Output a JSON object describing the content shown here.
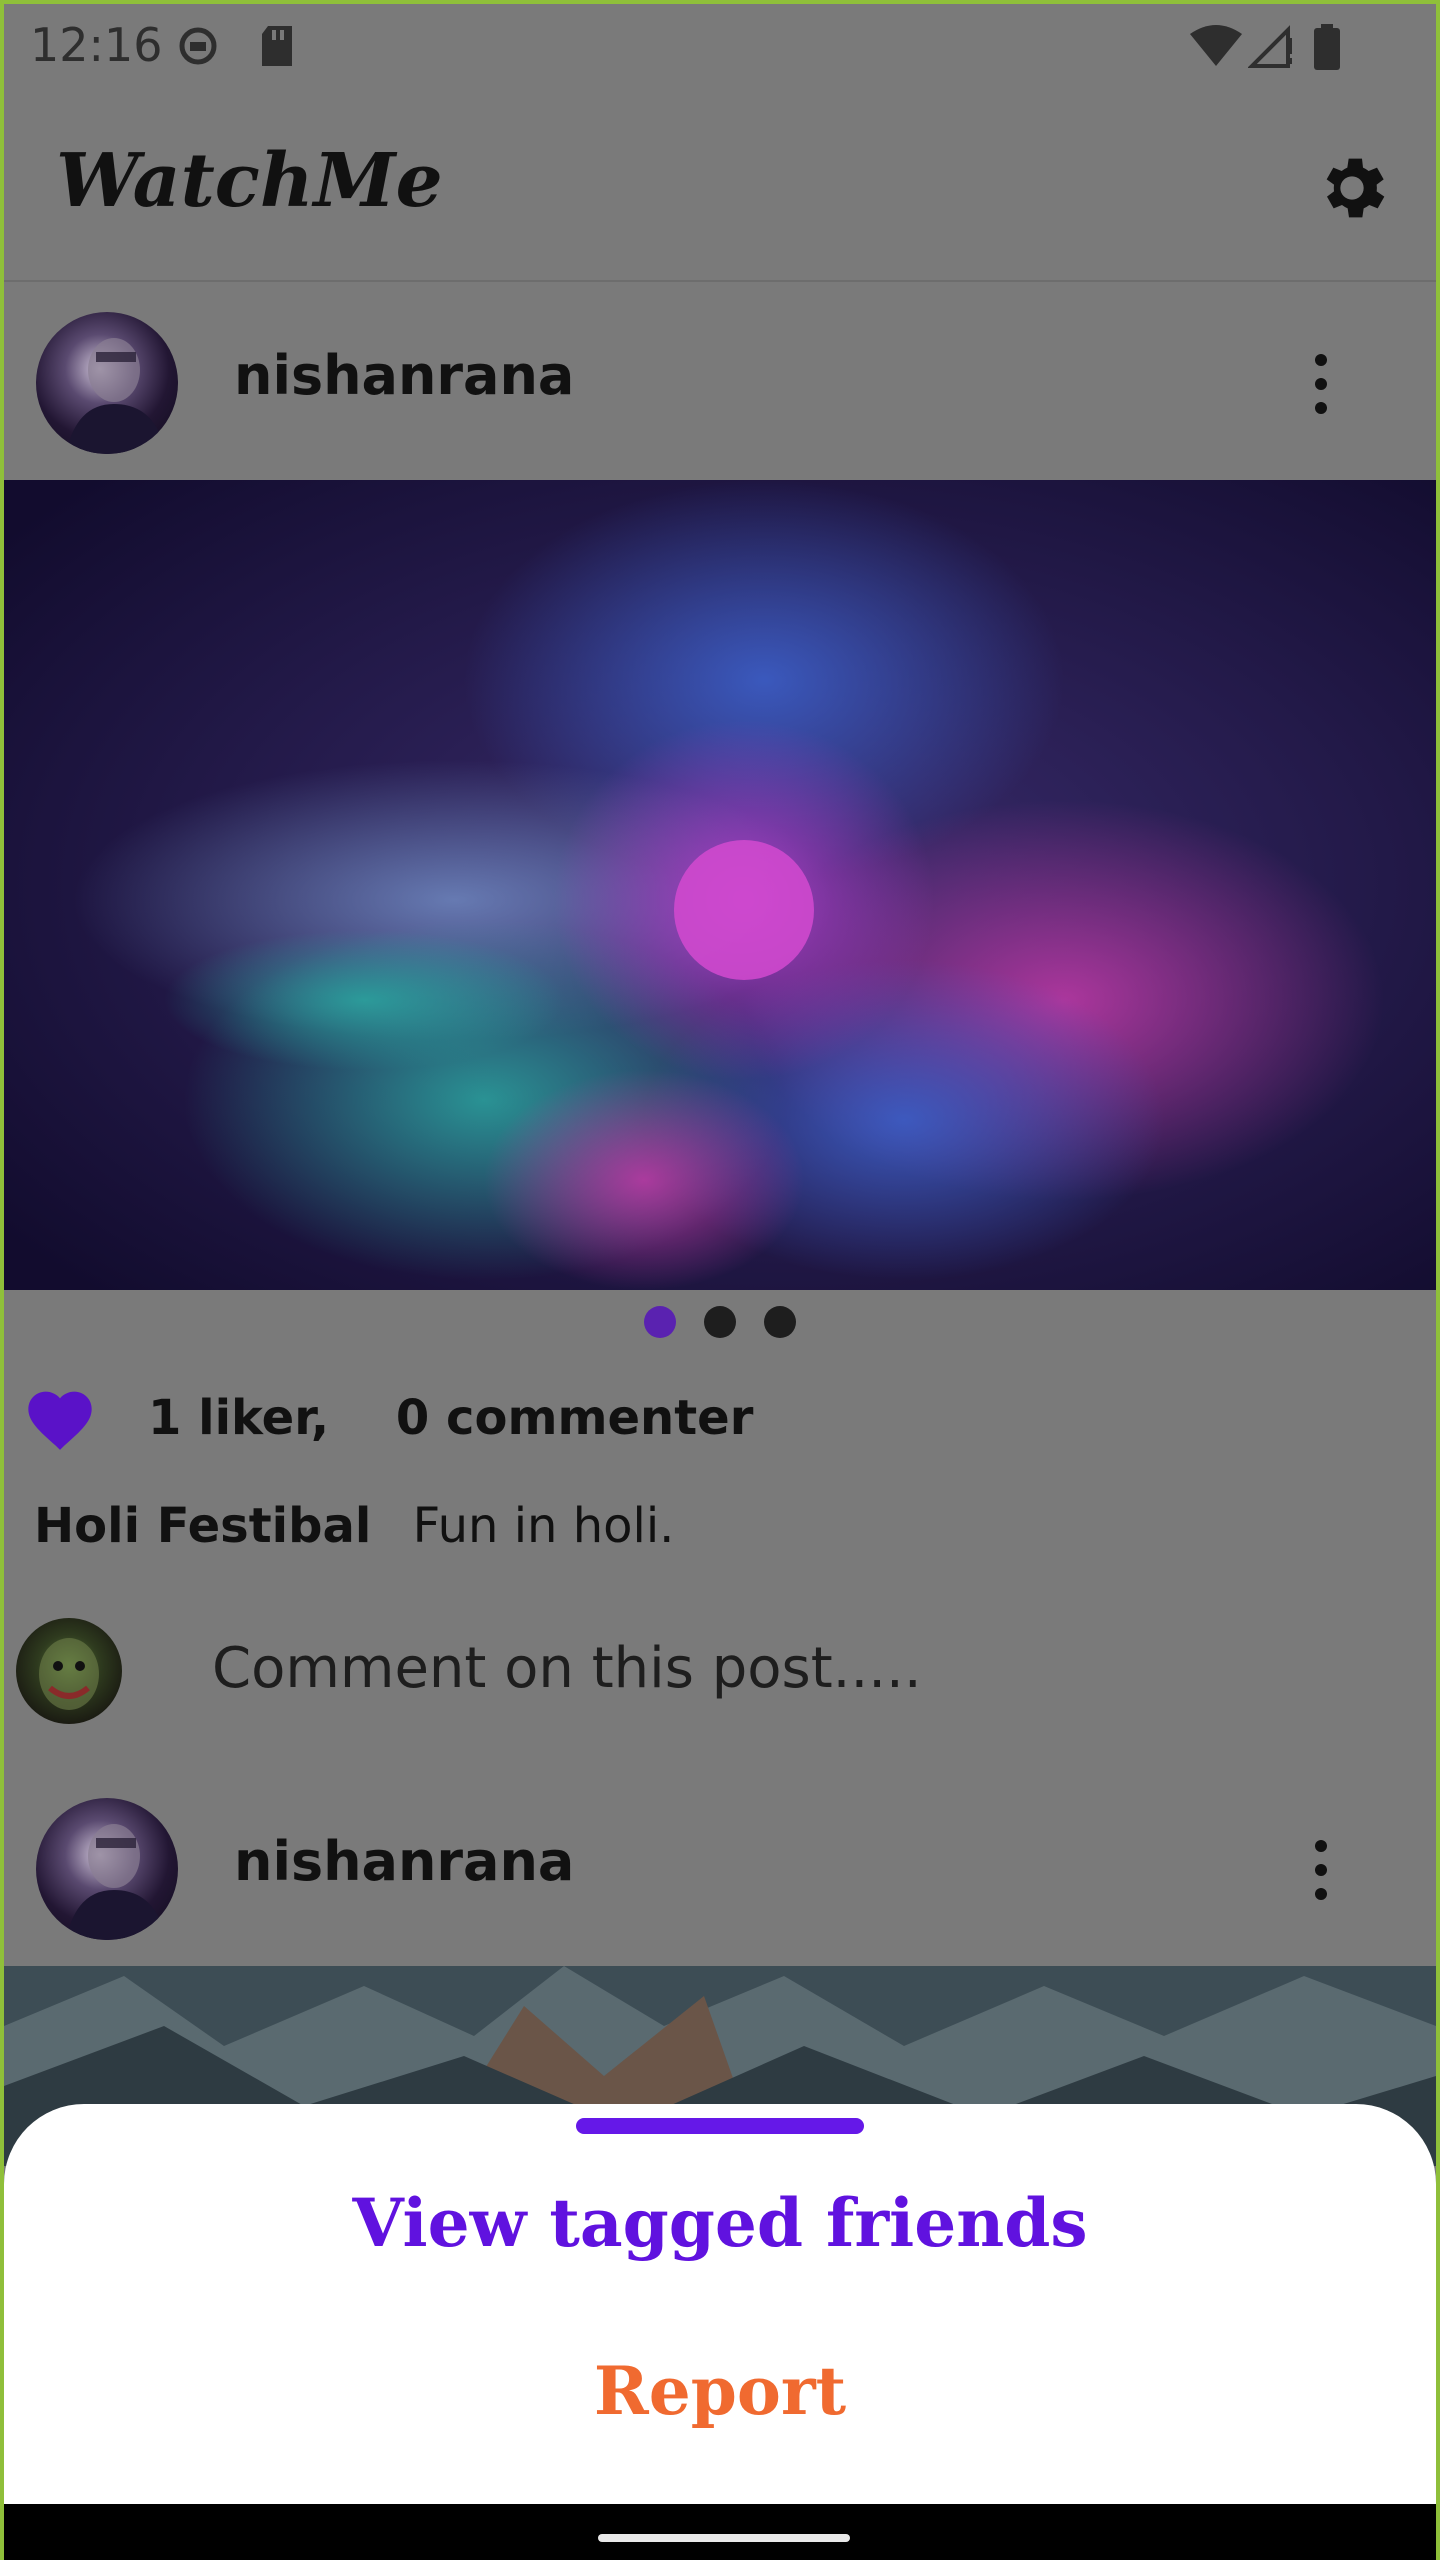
{
  "status_bar": {
    "time": "12:16"
  },
  "app_bar": {
    "title": "WatchMe"
  },
  "posts": [
    {
      "username": "nishanrana",
      "likes_text": "1 liker,    0 commenter",
      "caption_title": "Holi Festibal",
      "caption_text": "Fun in holi.",
      "comment_placeholder": "Comment on this post.....",
      "carousel": {
        "count": 3,
        "active": 1
      }
    },
    {
      "username": "nishanrana"
    }
  ],
  "bottom_sheet": {
    "options": [
      "View tagged friends",
      "Report"
    ]
  },
  "colors": {
    "accent": "#6012df",
    "report": "#f06a30",
    "heart": "#5a12c8",
    "scrim": "#7a7a7a"
  }
}
